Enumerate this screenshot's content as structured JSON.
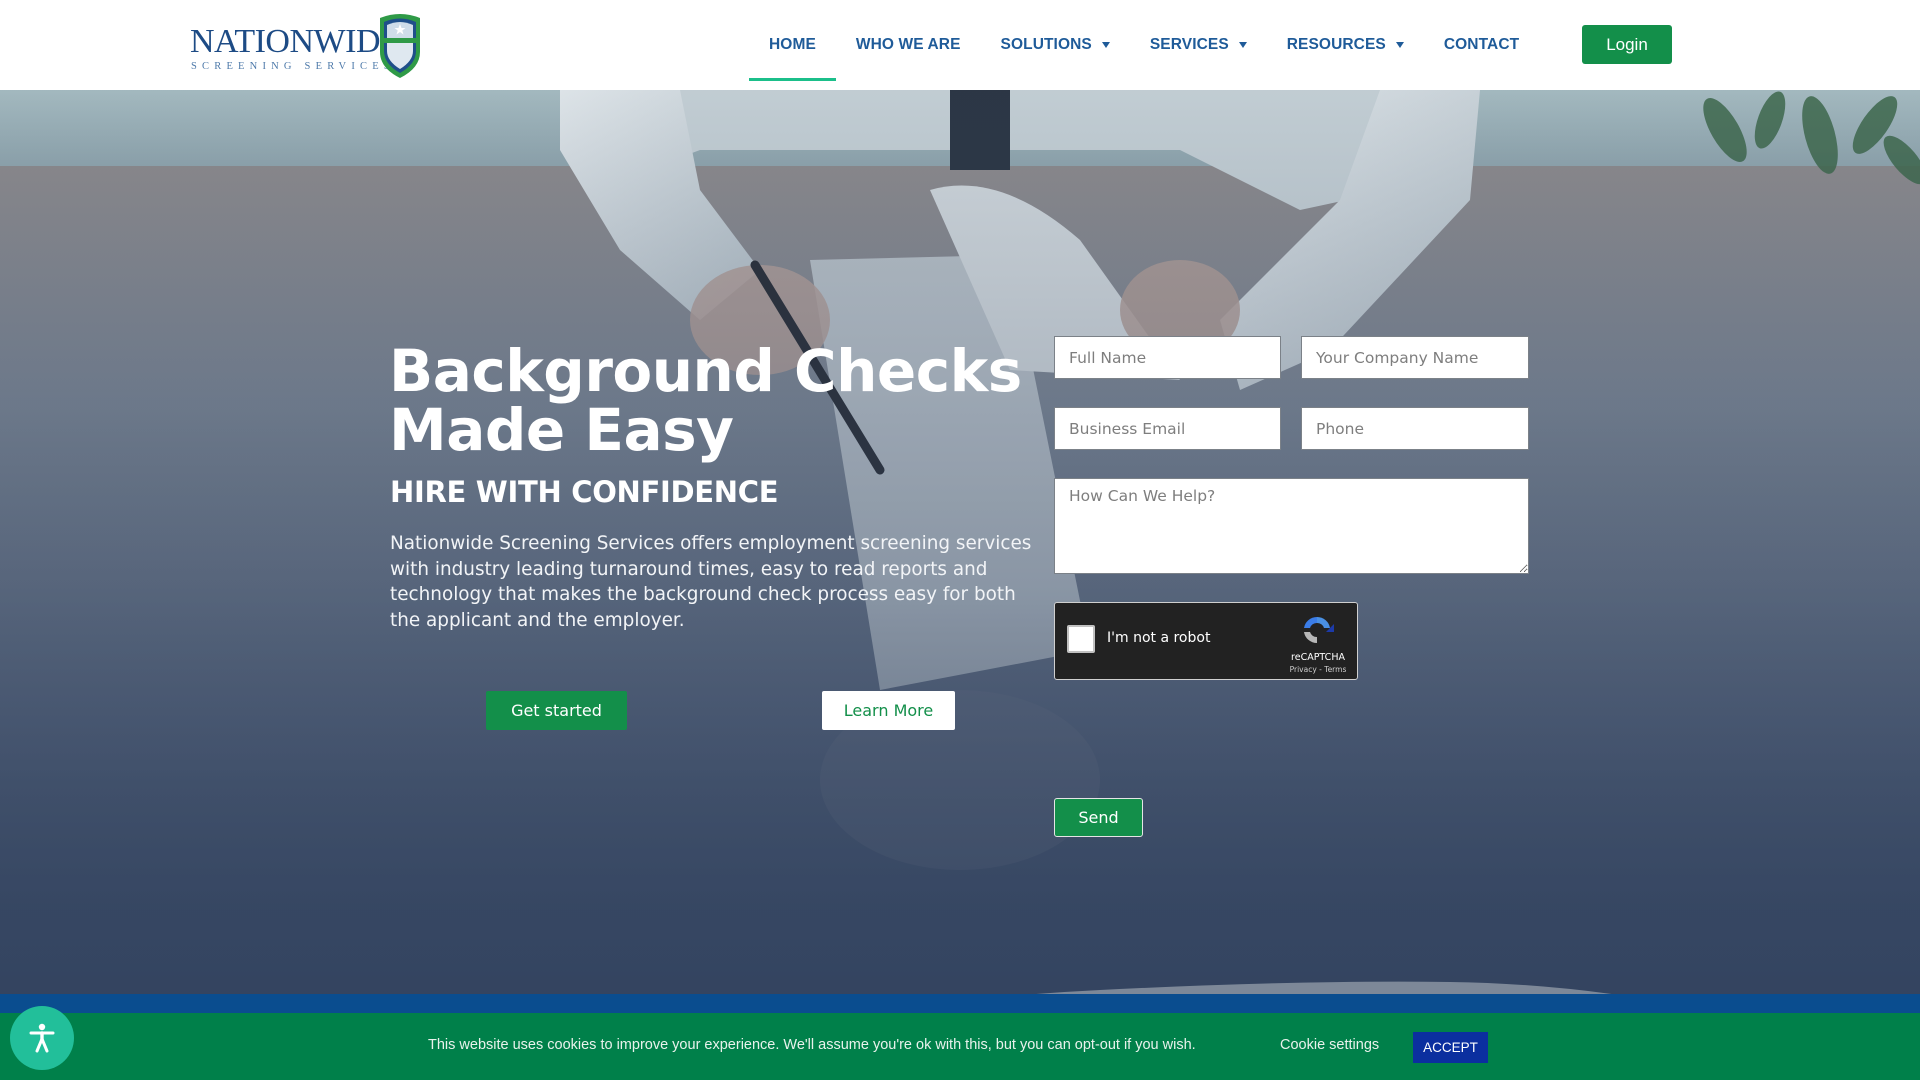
{
  "header": {
    "logo": {
      "wordmark": "NATIONWIDE",
      "tagline": "SCREENING SERVICES",
      "icon": "shield-star-icon"
    },
    "nav": [
      {
        "label": "HOME",
        "active": true,
        "has_dropdown": false
      },
      {
        "label": "WHO WE ARE",
        "active": false,
        "has_dropdown": false
      },
      {
        "label": "SOLUTIONS",
        "active": false,
        "has_dropdown": true
      },
      {
        "label": "SERVICES",
        "active": false,
        "has_dropdown": true
      },
      {
        "label": "RESOURCES",
        "active": false,
        "has_dropdown": true
      },
      {
        "label": "CONTACT",
        "active": false,
        "has_dropdown": false
      }
    ],
    "login_label": "Login"
  },
  "hero": {
    "title": "Background Checks Made Easy",
    "subtitle": "HIRE WITH CONFIDENCE",
    "body": "Nationwide Screening Services offers employment screening services with industry leading turnaround times, easy to read reports and technology that makes the background check process easy for both the applicant and the employer.",
    "get_started_label": "Get started",
    "learn_more_label": "Learn More"
  },
  "form": {
    "full_name": {
      "placeholder": "Full Name",
      "value": ""
    },
    "company_name": {
      "placeholder": "Your Company Name",
      "value": ""
    },
    "business_email": {
      "placeholder": "Business Email",
      "value": ""
    },
    "phone": {
      "placeholder": "Phone",
      "value": ""
    },
    "message": {
      "placeholder": "How Can We Help?",
      "value": ""
    },
    "captcha": {
      "label": "I'm not a robot",
      "brand": "reCAPTCHA",
      "privacy": "Privacy",
      "separator": " - ",
      "terms": "Terms",
      "checked": false
    },
    "send_label": "Send"
  },
  "cookie_bar": {
    "message": "This website uses cookies to improve your experience. We'll assume you're ok with this, but you can opt-out if you wish.",
    "settings_label": "Cookie settings",
    "accept_label": "ACCEPT"
  },
  "accessibility": {
    "icon": "accessibility-person-icon"
  },
  "colors": {
    "brand_blue": "#1f5b99",
    "brand_green": "#138f4a",
    "nav_active_underline": "#1bbf8a",
    "cookie_bar": "#00804a",
    "accept_button": "#0b2f9f",
    "footer_strip": "#0a4d8f",
    "accessibility_button": "#22bf9a"
  }
}
